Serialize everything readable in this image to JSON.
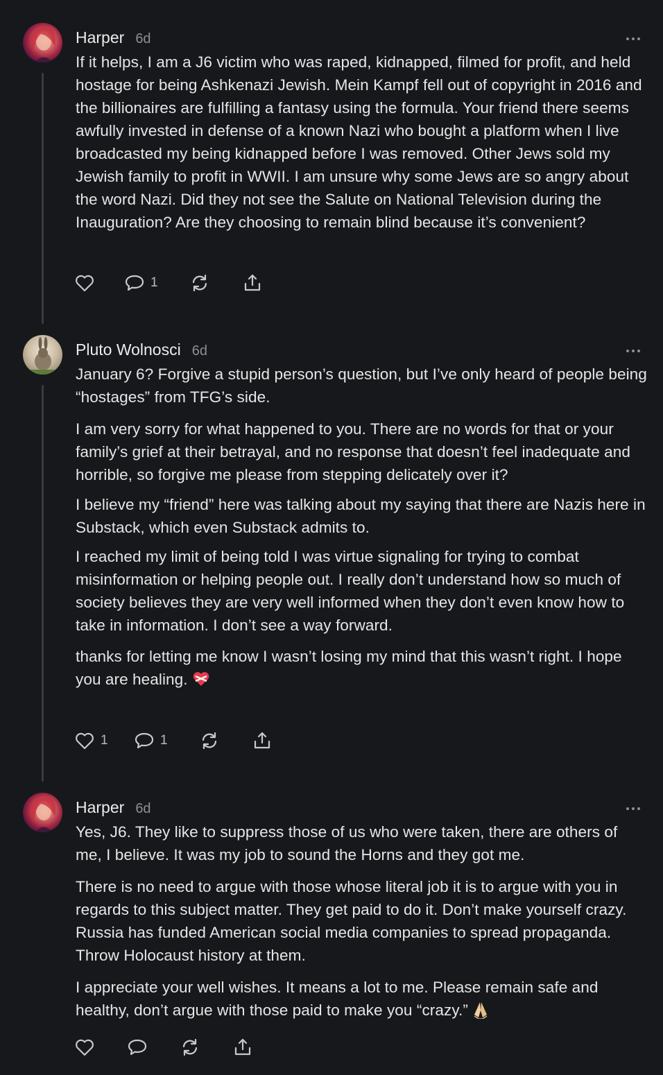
{
  "comments": [
    {
      "author": "Harper",
      "time": "6d",
      "avatar": "harper-avatar",
      "paragraphs": [
        "If it helps, I am a J6 victim who was raped, kidnapped, filmed for profit, and held hostage for being Ashkenazi Jewish. Mein Kampf fell out of copyright in 2016 and the billionaires are fulfilling a fantasy using the formula. Your friend there seems awfully invested in defense of a known Nazi who bought a platform when I live broadcasted my being kidnapped before I was removed. Other Jews sold my Jewish family to profit in WWII. I am unsure why some Jews are so angry about the word Nazi. Did they not see the Salute on National Television during the Inauguration? Are they choosing to remain blind because it’s convenient?"
      ],
      "like_count": "",
      "reply_count": "1"
    },
    {
      "author": "Pluto Wolnosci",
      "time": "6d",
      "avatar": "rabbit-avatar",
      "paragraphs": [
        "January 6? Forgive a stupid person’s question, but I’ve only heard of people being “hostages” from TFG’s side.",
        "I am very sorry for what happened to you. There are no words for that or your family’s grief at their betrayal, and no response that doesn’t feel inadequate and horrible, so forgive me please from stepping delicately over it?",
        "I believe my “friend” here was talking about my saying that there are Nazis here in Substack, which even Substack admits to.",
        "I reached my limit of being told I was virtue signaling for trying to combat misinformation or helping people out. I really don’t understand how so much of society believes they are very well informed when they don’t even know how to take in information. I don’t see a way forward.",
        "thanks for letting me know I wasn’t losing my mind that this wasn’t right. I hope you are healing."
      ],
      "emoji": "heart-with-ribbon-emoji",
      "like_count": "1",
      "reply_count": "1"
    },
    {
      "author": "Harper",
      "time": "6d",
      "avatar": "harper-avatar",
      "paragraphs": [
        "Yes, J6. They like to suppress those of us who were taken, there are others of me, I believe. It was my job to sound the Horns and they got me.",
        "There is no need to argue with those whose literal job it is to argue with you in regards to this subject matter. They get paid to do it. Don’t make yourself crazy. Russia has funded American social media companies to spread propaganda. Throw Holocaust history at them.",
        "I appreciate your well wishes. It means a lot to me. Please remain safe and healthy, don’t argue with those paid to make you “crazy.”"
      ],
      "emoji": "folded-hands-emoji",
      "like_count": "",
      "reply_count": ""
    }
  ],
  "icons": {
    "like": "heart-outline-icon",
    "reply": "speech-bubble-icon",
    "restack": "refresh-arrows-icon",
    "share": "share-upload-icon",
    "more": "ellipsis-icon"
  },
  "colors": {
    "background": "#17181b",
    "text": "#e6e6e6",
    "muted": "#8d8f94",
    "thread_line": "#3a3b3f"
  }
}
